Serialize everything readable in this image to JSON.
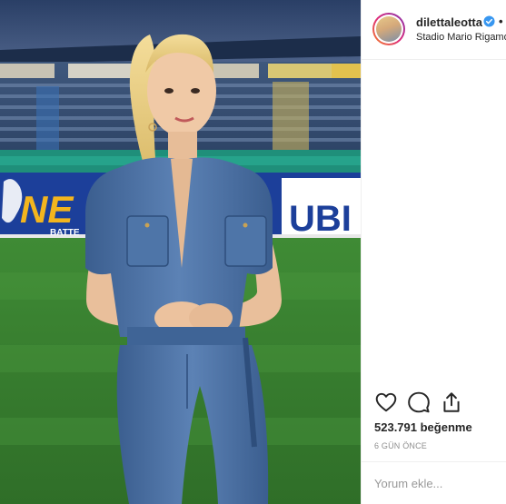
{
  "post": {
    "username": "dilettaleotta",
    "separator": "•",
    "location": "Stadio Mario Rigamonti",
    "likes": "523.791 beğenme",
    "time": "6 GÜN ÖNCE"
  },
  "banner": {
    "left_text": "NE",
    "left_subtext": "BATTE",
    "right_text": "UBI"
  },
  "comment": {
    "placeholder": "Yorum ekle..."
  },
  "colors": {
    "verified": "#3897f0",
    "muted_text": "#8e8e8e",
    "border": "#efefef",
    "banner_blue": "#1c3f9a",
    "banner_yellow": "#f3b51e"
  },
  "icons": {
    "like": "heart-icon",
    "comment": "comment-icon",
    "share": "share-icon",
    "verified": "verified-badge-icon"
  }
}
